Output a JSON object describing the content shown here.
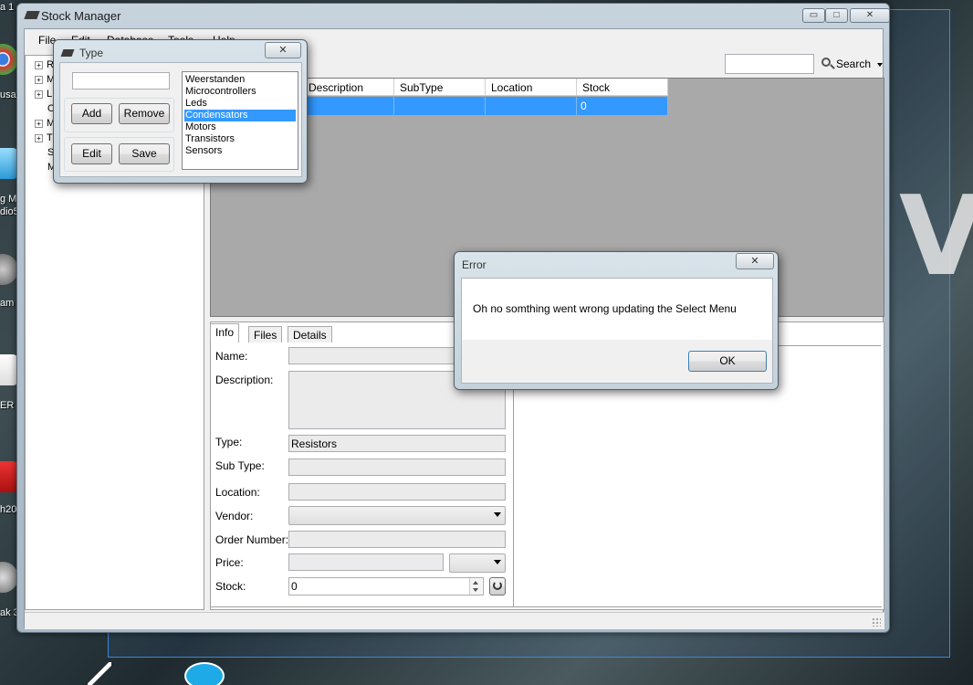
{
  "desktop": {
    "labels": [
      "a 1",
      "usa",
      "g M",
      "dio5",
      "am",
      "ER C",
      "h20",
      "ak 3"
    ],
    "background_text": "V"
  },
  "main_window": {
    "title": "Stock Manager",
    "controls": {
      "minimize": "▭",
      "maximize": "□",
      "close": "✕"
    },
    "menu": [
      "File",
      "Edit",
      "Database",
      "Tools",
      "Help"
    ],
    "search": {
      "value": "",
      "button_label": "Search"
    },
    "tree": [
      {
        "expander": "+",
        "label": "R"
      },
      {
        "expander": "+",
        "label": "M"
      },
      {
        "expander": "+",
        "label": "L"
      },
      {
        "expander": "",
        "label": "O"
      },
      {
        "expander": "+",
        "label": "M"
      },
      {
        "expander": "+",
        "label": "T"
      },
      {
        "expander": "",
        "label": "S"
      },
      {
        "expander": "",
        "label": "M"
      }
    ],
    "grid": {
      "columns": [
        "Description",
        "SubType",
        "Location",
        "Stock"
      ],
      "rows": [
        [
          "",
          "",
          "",
          "0"
        ]
      ]
    },
    "tabs": [
      "Info",
      "Files",
      "Details"
    ],
    "form": {
      "name_label": "Name:",
      "name_value": "",
      "description_label": "Description:",
      "description_value": "",
      "type_label": "Type:",
      "type_value": "Resistors",
      "subtype_label": "Sub Type:",
      "subtype_value": "",
      "location_label": "Location:",
      "location_value": "",
      "vendor_label": "Vendor:",
      "vendor_value": "",
      "order_number_label": "Order Number:",
      "order_number_value": "",
      "price_label": "Price:",
      "price_value": "",
      "currency_value": "",
      "stock_label": "Stock:",
      "stock_value": "0"
    }
  },
  "type_dialog": {
    "title": "Type",
    "close": "✕",
    "input_value": "",
    "buttons": {
      "add": "Add",
      "remove": "Remove",
      "edit": "Edit",
      "save": "Save"
    },
    "items": [
      "Weerstanden",
      "Microcontrollers",
      "Leds",
      "Condensators",
      "Motors",
      "Transistors",
      "Sensors"
    ],
    "selected": "Condensators"
  },
  "error_dialog": {
    "title": "Error",
    "close": "✕",
    "message": "Oh no somthing went wrong updating the Select Menu",
    "ok": "OK"
  },
  "colors": {
    "selection": "#3399ff",
    "grid_background": "#a9a9a9",
    "window_frame": "#b3c2ce"
  }
}
